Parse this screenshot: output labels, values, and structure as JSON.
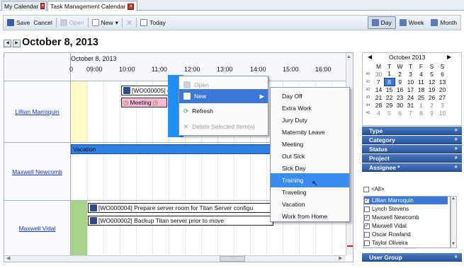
{
  "tabs": [
    {
      "label": "My Calendar"
    },
    {
      "label": "Task Management Calendar"
    }
  ],
  "toolbar": {
    "save": "Save",
    "cancel": "Cancel",
    "open": "Open",
    "new": "New",
    "today": "Today",
    "day": "Day",
    "week": "Week",
    "month": "Month"
  },
  "date_title": "October 8, 2013",
  "header_date": "October 8, 2013",
  "times": [
    "09:00",
    "10:00",
    "11:00",
    "12:00",
    "13:00",
    "14:00",
    "15:00",
    "16:00"
  ],
  "resources": [
    "Lillian Marroquin",
    "Maxwell Newcomb",
    "Maxwell Vidal"
  ],
  "appointments": {
    "wo5": "[WO000005] ca",
    "meeting": "Meeting",
    "vacation": "Vacation",
    "wo4": "[WO000004] Prepare server room for Titan Server configu",
    "wo2": "[WO000002] Backup Titan server prior to move"
  },
  "context_menu": {
    "open": "Open",
    "new": "New",
    "refresh": "Refresh",
    "delete": "Delete Selected Item(s)"
  },
  "submenu": [
    "Day Off",
    "Extra Work",
    "Jury Duty",
    "Maternity Leave",
    "Meeting",
    "Out Sick",
    "Sick Day",
    "Training",
    "Traveling",
    "Vacation",
    "Work from Home"
  ],
  "mini_calendar": {
    "month": "October 2013",
    "weekdays": [
      "M",
      "T",
      "W",
      "T",
      "F",
      "S",
      "S"
    ],
    "weeks": [
      {
        "wk": "40",
        "days": [
          "30",
          "1",
          "2",
          "3",
          "4",
          "5",
          "6"
        ]
      },
      {
        "wk": "41",
        "days": [
          "7",
          "8",
          "9",
          "10",
          "11",
          "12",
          "13"
        ]
      },
      {
        "wk": "42",
        "days": [
          "14",
          "15",
          "16",
          "17",
          "18",
          "19",
          "20"
        ]
      },
      {
        "wk": "43",
        "days": [
          "21",
          "22",
          "23",
          "24",
          "25",
          "26",
          "27"
        ]
      },
      {
        "wk": "44",
        "days": [
          "28",
          "29",
          "30",
          "31",
          "1",
          "2",
          "3"
        ]
      },
      {
        "wk": "45",
        "days": [
          "4",
          "5",
          "6",
          "7",
          "8",
          "9",
          "10"
        ]
      }
    ],
    "selected": "8"
  },
  "filters": {
    "type": "Type",
    "category": "Category",
    "status": "Status",
    "project": "Project",
    "assignee": "Assignee *",
    "user_group": "User Group",
    "all": "<All>",
    "people": [
      {
        "name": "Lillian Marroquin",
        "checked": "✓"
      },
      {
        "name": "Lynch Stevens",
        "checked": ""
      },
      {
        "name": "Maxwell Newcomb",
        "checked": "✓"
      },
      {
        "name": "Maxwell Vidal",
        "checked": "✓"
      },
      {
        "name": "Oscar Rowland",
        "checked": ""
      },
      {
        "name": "Taylor Oliveira",
        "checked": ""
      }
    ]
  },
  "colors": {
    "accent": "#3c78d8",
    "selection": "#1e90ff",
    "meeting": "#f7b9d8",
    "vacation": "#2f7fe0",
    "training_hl": "#3b8cf0"
  }
}
